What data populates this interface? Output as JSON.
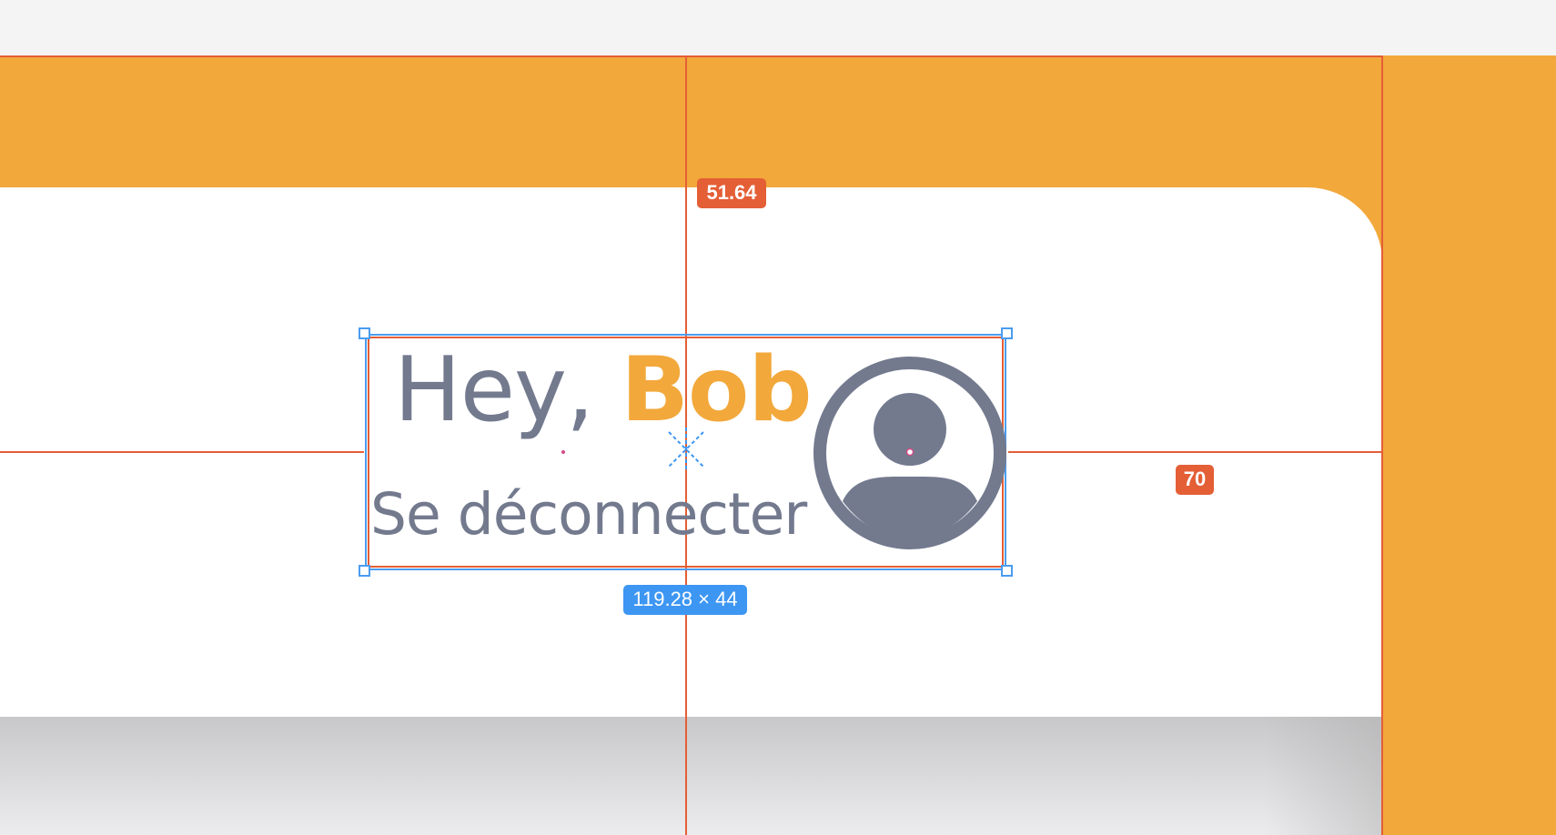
{
  "canvas": {
    "frame_color": "#f2a83b",
    "background": "#f4f4f4",
    "card_color": "#ffffff"
  },
  "measurements": {
    "top_distance": "51.64",
    "right_distance": "70",
    "selection_size": "119.28 × 44"
  },
  "user_menu": {
    "greeting": "Hey,",
    "name": "Bob",
    "logout_label": "Se déconnecter",
    "avatar_icon": "user-circle-icon"
  },
  "colors": {
    "accent": "#f2a83b",
    "text": "#737a8e",
    "guide": "#e45e36",
    "selection": "#3d96f2"
  }
}
